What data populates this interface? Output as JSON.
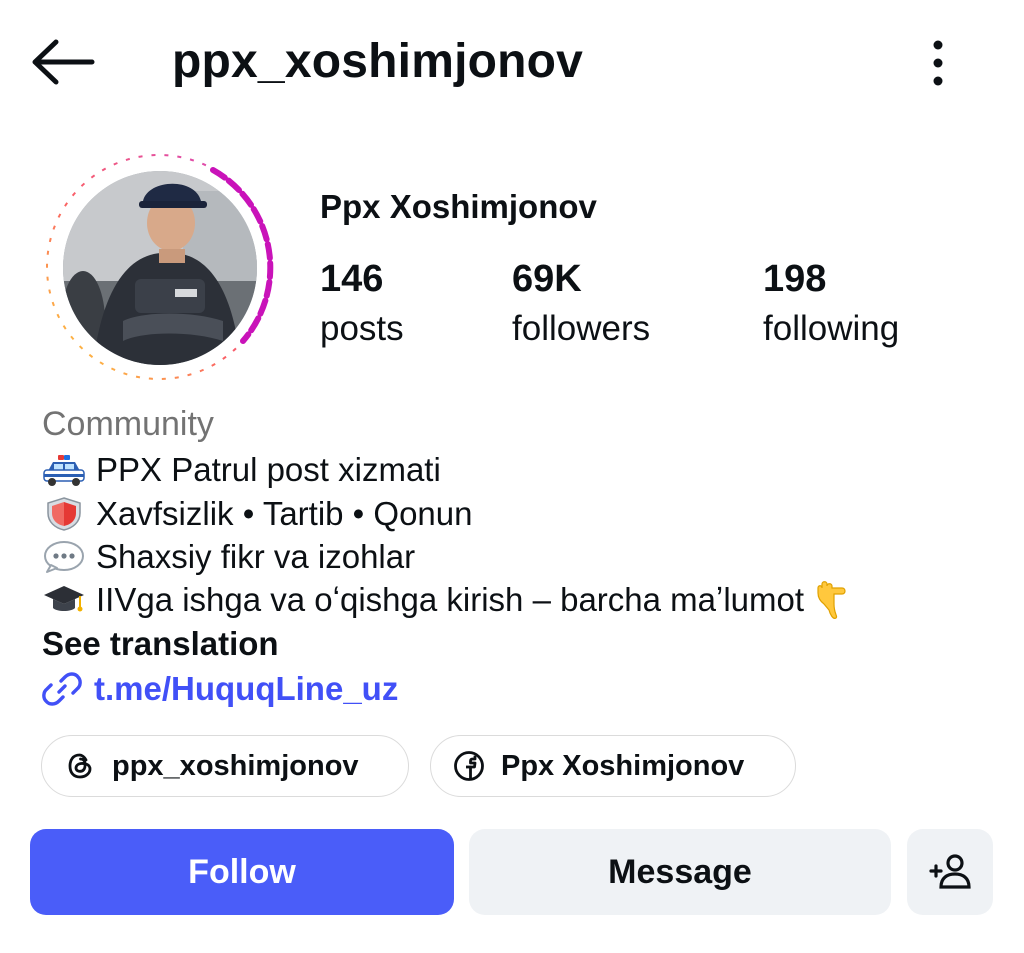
{
  "header": {
    "username": "ppx_xoshimjonov",
    "back_icon": "back-arrow-icon",
    "more_icon": "more-vertical-icon"
  },
  "profile": {
    "display_name": "Ppx Xoshimjonov",
    "avatar_icon": "profile-photo",
    "story_ring_colors": [
      "#c913b9",
      "#f9373f",
      "#fecd00"
    ],
    "stats": {
      "posts": {
        "value": "146",
        "label": "posts"
      },
      "followers": {
        "value": "69K",
        "label": "followers"
      },
      "following": {
        "value": "198",
        "label": "following"
      }
    }
  },
  "bio": {
    "category": "Community",
    "lines": [
      {
        "emoji": "police-car-icon",
        "text": "PPX Patrul post xizmati"
      },
      {
        "emoji": "shield-icon",
        "text": "Xavfsizlik • Tartib • Qonun"
      },
      {
        "emoji": "speech-bubble-icon",
        "text": "Shaxsiy fikr va izohlar"
      },
      {
        "emoji": "graduation-cap-icon",
        "text": "IIVga ishga va oʻqishga kirish – barcha maʼlumot",
        "trailing_emoji": "pointing-down-hand-icon"
      }
    ],
    "see_translation": "See translation",
    "link": {
      "icon": "link-icon",
      "text": "t.me/HuquqLine_uz"
    }
  },
  "chips": [
    {
      "icon": "threads-icon",
      "label": "ppx_xoshimjonov"
    },
    {
      "icon": "facebook-icon",
      "label": "Ppx Xoshimjonov"
    }
  ],
  "actions": {
    "follow": "Follow",
    "message": "Message",
    "add_person_icon": "add-person-icon"
  },
  "colors": {
    "accent": "#4a5df9",
    "link": "#4150f7",
    "secondary_button": "#eff2f5",
    "muted_text": "#737373"
  }
}
